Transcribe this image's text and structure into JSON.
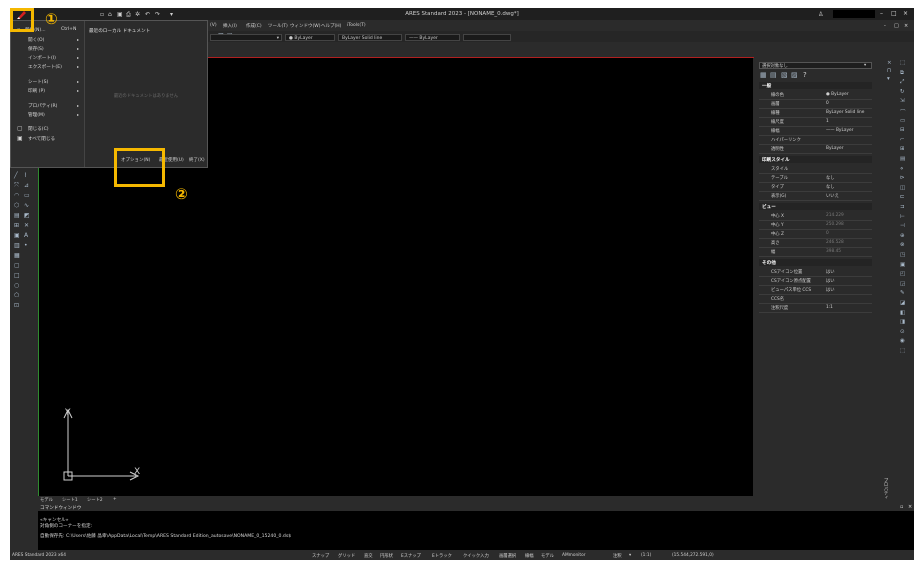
{
  "window": {
    "title": "ARES Standard 2023 - [NONAME_0.dwg*]",
    "controls": [
      "–",
      "□",
      "×"
    ],
    "doc_controls": [
      "-",
      "□",
      "×"
    ]
  },
  "menu": {
    "items": [
      "(V)",
      "挿入(I)",
      "作成(C)",
      "ツール(T)",
      "ウィンドウ(W)",
      "ヘルプ(H)",
      "iTools(T)"
    ]
  },
  "ribbon": {
    "layer_value": "● ByLayer",
    "linetype_value": "ByLayer",
    "linetype_name": "Solid line",
    "lineweight_value": "—— ByLayer"
  },
  "file_menu": {
    "new_label": "新規(N)...",
    "new_shortcut": "Ctrl+N",
    "items": [
      {
        "label": "開く(O)",
        "arrow": "▸"
      },
      {
        "label": "保存(S)",
        "arrow": "▸"
      },
      {
        "label": "インポート(I)",
        "arrow": "▸"
      },
      {
        "label": "エクスポート(E)",
        "arrow": "▸"
      },
      {
        "label": "シート(S)",
        "arrow": "▸"
      },
      {
        "label": "印刷 (P)",
        "arrow": "▸"
      },
      {
        "label": "プロパティ(R)",
        "arrow": "▸"
      },
      {
        "label": "管理(M)",
        "arrow": "▸"
      },
      {
        "label": "閉じる(C)",
        "arrow": ""
      },
      {
        "label": "すべて閉じる",
        "arrow": ""
      }
    ],
    "recent_header": "最近のローカル ドキュメント",
    "empty_text": "最近のドキュメントはありません",
    "options_button": "オプション(N)",
    "recent_button": "最近使用(U)",
    "exit_button": "終了(X)"
  },
  "callouts": {
    "one": "①",
    "two": "②"
  },
  "canvas": {
    "axis_y": "Y",
    "axis_x": "X"
  },
  "properties": {
    "selection": "選択対象なし",
    "sections": [
      {
        "title": "一般",
        "rows": [
          {
            "label": "線の色",
            "value": "● ByLayer"
          },
          {
            "label": "画層",
            "value": "0"
          },
          {
            "label": "線種",
            "value": "ByLayer   Solid line"
          },
          {
            "label": "線尺度",
            "value": "1"
          },
          {
            "label": "線幅",
            "value": "—— ByLayer"
          },
          {
            "label": "ハイパーリンク",
            "value": ""
          },
          {
            "label": "透明性",
            "value": "ByLayer"
          }
        ]
      },
      {
        "title": "印刷スタイル",
        "rows": [
          {
            "label": "スタイル",
            "value": ""
          },
          {
            "label": "テーブル",
            "value": "なし"
          },
          {
            "label": "タイプ",
            "value": "なし"
          },
          {
            "label": "表示(G)",
            "value": "いいえ"
          }
        ]
      },
      {
        "title": "ビュー",
        "rows": [
          {
            "label": "中心 X",
            "value": "214.229"
          },
          {
            "label": "中心 Y",
            "value": "250.298"
          },
          {
            "label": "中心 Z",
            "value": "0"
          },
          {
            "label": "高さ",
            "value": "246.528"
          },
          {
            "label": "幅",
            "value": "398.45"
          }
        ]
      },
      {
        "title": "その他",
        "rows": [
          {
            "label": "CSアイコン位置",
            "value": "はい"
          },
          {
            "label": "CSアイコン原点配置",
            "value": "はい"
          },
          {
            "label": "ビューパス単位 CCS",
            "value": "はい"
          },
          {
            "label": "CCS名",
            "value": ""
          },
          {
            "label": "注釈尺度",
            "value": "1:1"
          }
        ]
      }
    ],
    "side_tab": "プロパティ"
  },
  "bottom_tabs": [
    "モデル",
    "シート1",
    "シート2",
    "+"
  ],
  "command": {
    "header": "コマンドウィンドウ",
    "lines": [
      "«キャンセル»",
      "対角側のコーナーを指定:",
      "自動保存先: C:\\Users\\佐藤 晶幸\\AppData\\Local\\Temp\\ARES Standard Edition_autosave\\NONAME_0_15240_0.ds$"
    ]
  },
  "status": {
    "app": "ARES Standard 2023 x64",
    "items": [
      "スナップ",
      "グリッド",
      "直交",
      "円形状",
      "Eスナップ",
      "Eトラック",
      "クイック入力",
      "画層選択",
      "線幅",
      "モデル",
      "AMmonitor",
      "注釈",
      "▾",
      "(1:1)",
      "(15.544,272.591,0)"
    ]
  }
}
